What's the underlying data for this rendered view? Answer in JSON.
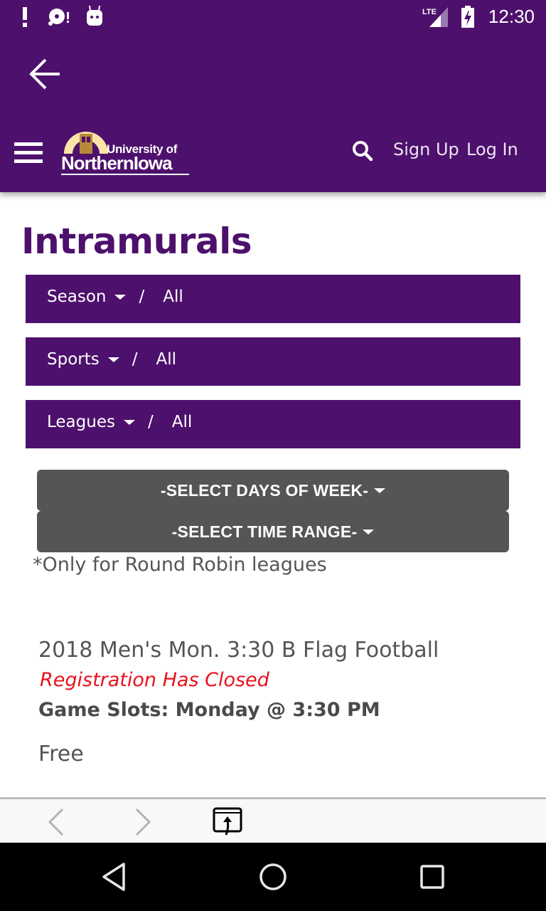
{
  "status_bar": {
    "time": "12:30",
    "network": "LTE",
    "icons": [
      "alert-icon",
      "sd-card-alert-icon",
      "android-debug-icon",
      "signal-icon",
      "battery-charging-icon"
    ]
  },
  "app_bar": {
    "back_icon": "arrow-left-icon",
    "menu_icon": "hamburger-icon",
    "logo": {
      "line1": "University of",
      "line2": "NorthernIowa"
    },
    "search_icon": "search-icon",
    "sign_up": "Sign Up",
    "log_in": "Log In"
  },
  "page": {
    "title": "Intramurals",
    "filters": [
      {
        "label": "Season",
        "separator": "/",
        "value": "All"
      },
      {
        "label": "Sports",
        "separator": "/",
        "value": "All"
      },
      {
        "label": "Leagues",
        "separator": "/",
        "value": "All"
      }
    ],
    "select_days": "-SELECT DAYS OF WEEK-",
    "select_time": "-SELECT TIME RANGE-",
    "note": "*Only for Round Robin leagues",
    "events": [
      {
        "title": "2018 Men's Mon. 3:30 B Flag Football",
        "status": "Registration Has Closed",
        "game_slots": "Game Slots: Monday @ 3:30 PM",
        "price": "Free"
      }
    ]
  },
  "colors": {
    "brand_purple": "#4d106c",
    "button_gray": "#555555",
    "status_red": "#e8121c"
  },
  "browser_bar": {
    "icons": [
      "chevron-left-icon",
      "chevron-right-icon",
      "open-in-browser-icon"
    ]
  },
  "nav_bar": {
    "icons": [
      "nav-back-icon",
      "nav-home-icon",
      "nav-recents-icon"
    ]
  }
}
